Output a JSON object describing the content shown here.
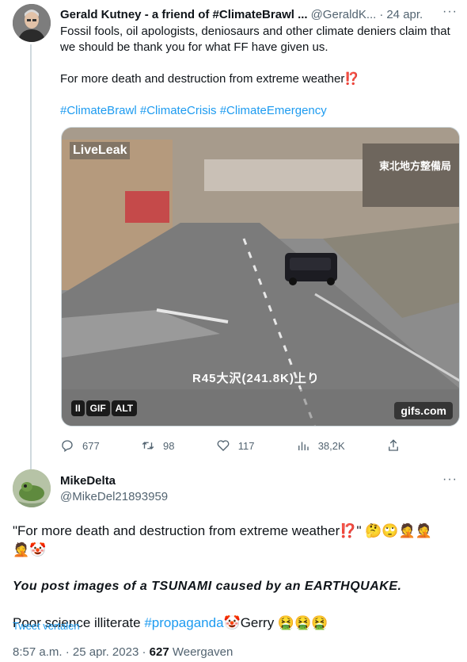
{
  "tweet1": {
    "display_name": "Gerald Kutney - a friend of #ClimateBrawl ...",
    "handle": "@GeraldK...",
    "separator": "·",
    "date": "24 apr.",
    "more_icon": "more-dots-icon",
    "text_line1": "Fossil fools, oil apologists, deniosaurs and other climate deniers claim that we should be thank you for what FF have given us.",
    "text_line2": "For more death and destruction from extreme weather",
    "text_line2_emoji": "⁉️",
    "hashtags": "#ClimateBrawl #ClimateCrisis #ClimateEmergency",
    "media": {
      "overlay_top_left": "LiveLeak",
      "overlay_top_right": "東北地方整備局",
      "overlay_caption": "R45大沢(241.8K)上り",
      "badges": [
        "II",
        "GIF",
        "ALT"
      ],
      "brand": "gifs.com"
    },
    "actions": {
      "replies": "677",
      "retweets": "98",
      "likes": "117",
      "views": "38,2K"
    }
  },
  "tweet2": {
    "display_name": "MikeDelta",
    "handle": "@MikeDel21893959",
    "line1_text": "\"For more death and destruction from extreme weather",
    "line1_end": "\"",
    "line1_emojis_after": "🤔🙄🤦🤦",
    "line1_emojis_wrap": "🤦🤡",
    "strong_line": "You post images of a TSUNAMI caused by an EARTHQUAKE.",
    "line3_prefix": "Poor science illiterate ",
    "line3_tag": "#propaganda",
    "line3_mid": "🤡Gerry ",
    "line3_emojis": "🤮🤮🤮",
    "translate_link": "Tweet vertalen",
    "time": "8:57 a.m.",
    "date": "25 apr. 2023",
    "views_count": "627",
    "views_label": "Weergaven"
  },
  "colors": {
    "accent": "#1d9bf0",
    "secondary_text": "#536471",
    "thread_line": "#cfd9de"
  }
}
